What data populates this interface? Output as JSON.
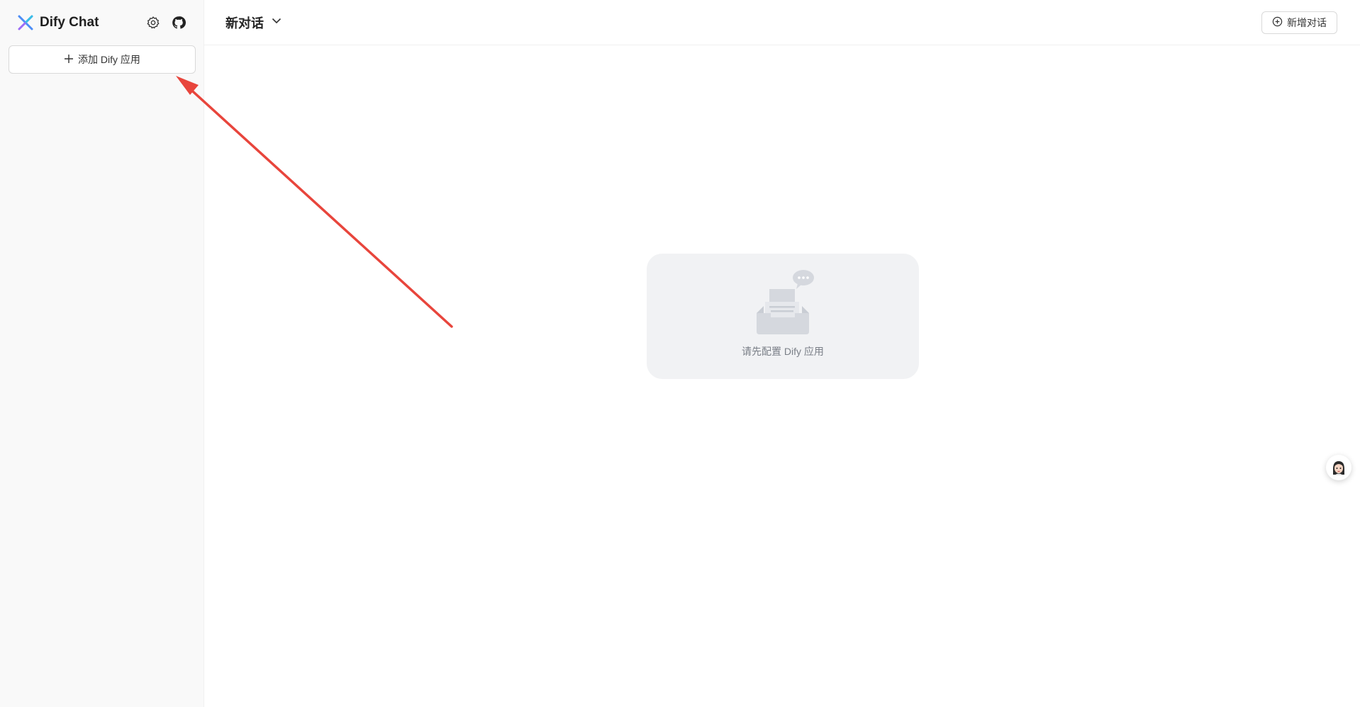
{
  "sidebar": {
    "app_name": "Dify Chat",
    "add_app_label": "添加 Dify 应用",
    "icons": [
      "logo-icon",
      "gear-icon",
      "github-icon",
      "plus-icon"
    ]
  },
  "header": {
    "conversation_title": "新对话",
    "new_conversation_label": "新增对话",
    "icons": [
      "chevron-down-icon",
      "plus-circle-icon"
    ]
  },
  "main": {
    "empty_state_text": "请先配置 Dify 应用"
  },
  "colors": {
    "sidebar_bg": "#f9f9f9",
    "card_bg": "#f1f2f4",
    "annotation_arrow": "#e8453c"
  }
}
